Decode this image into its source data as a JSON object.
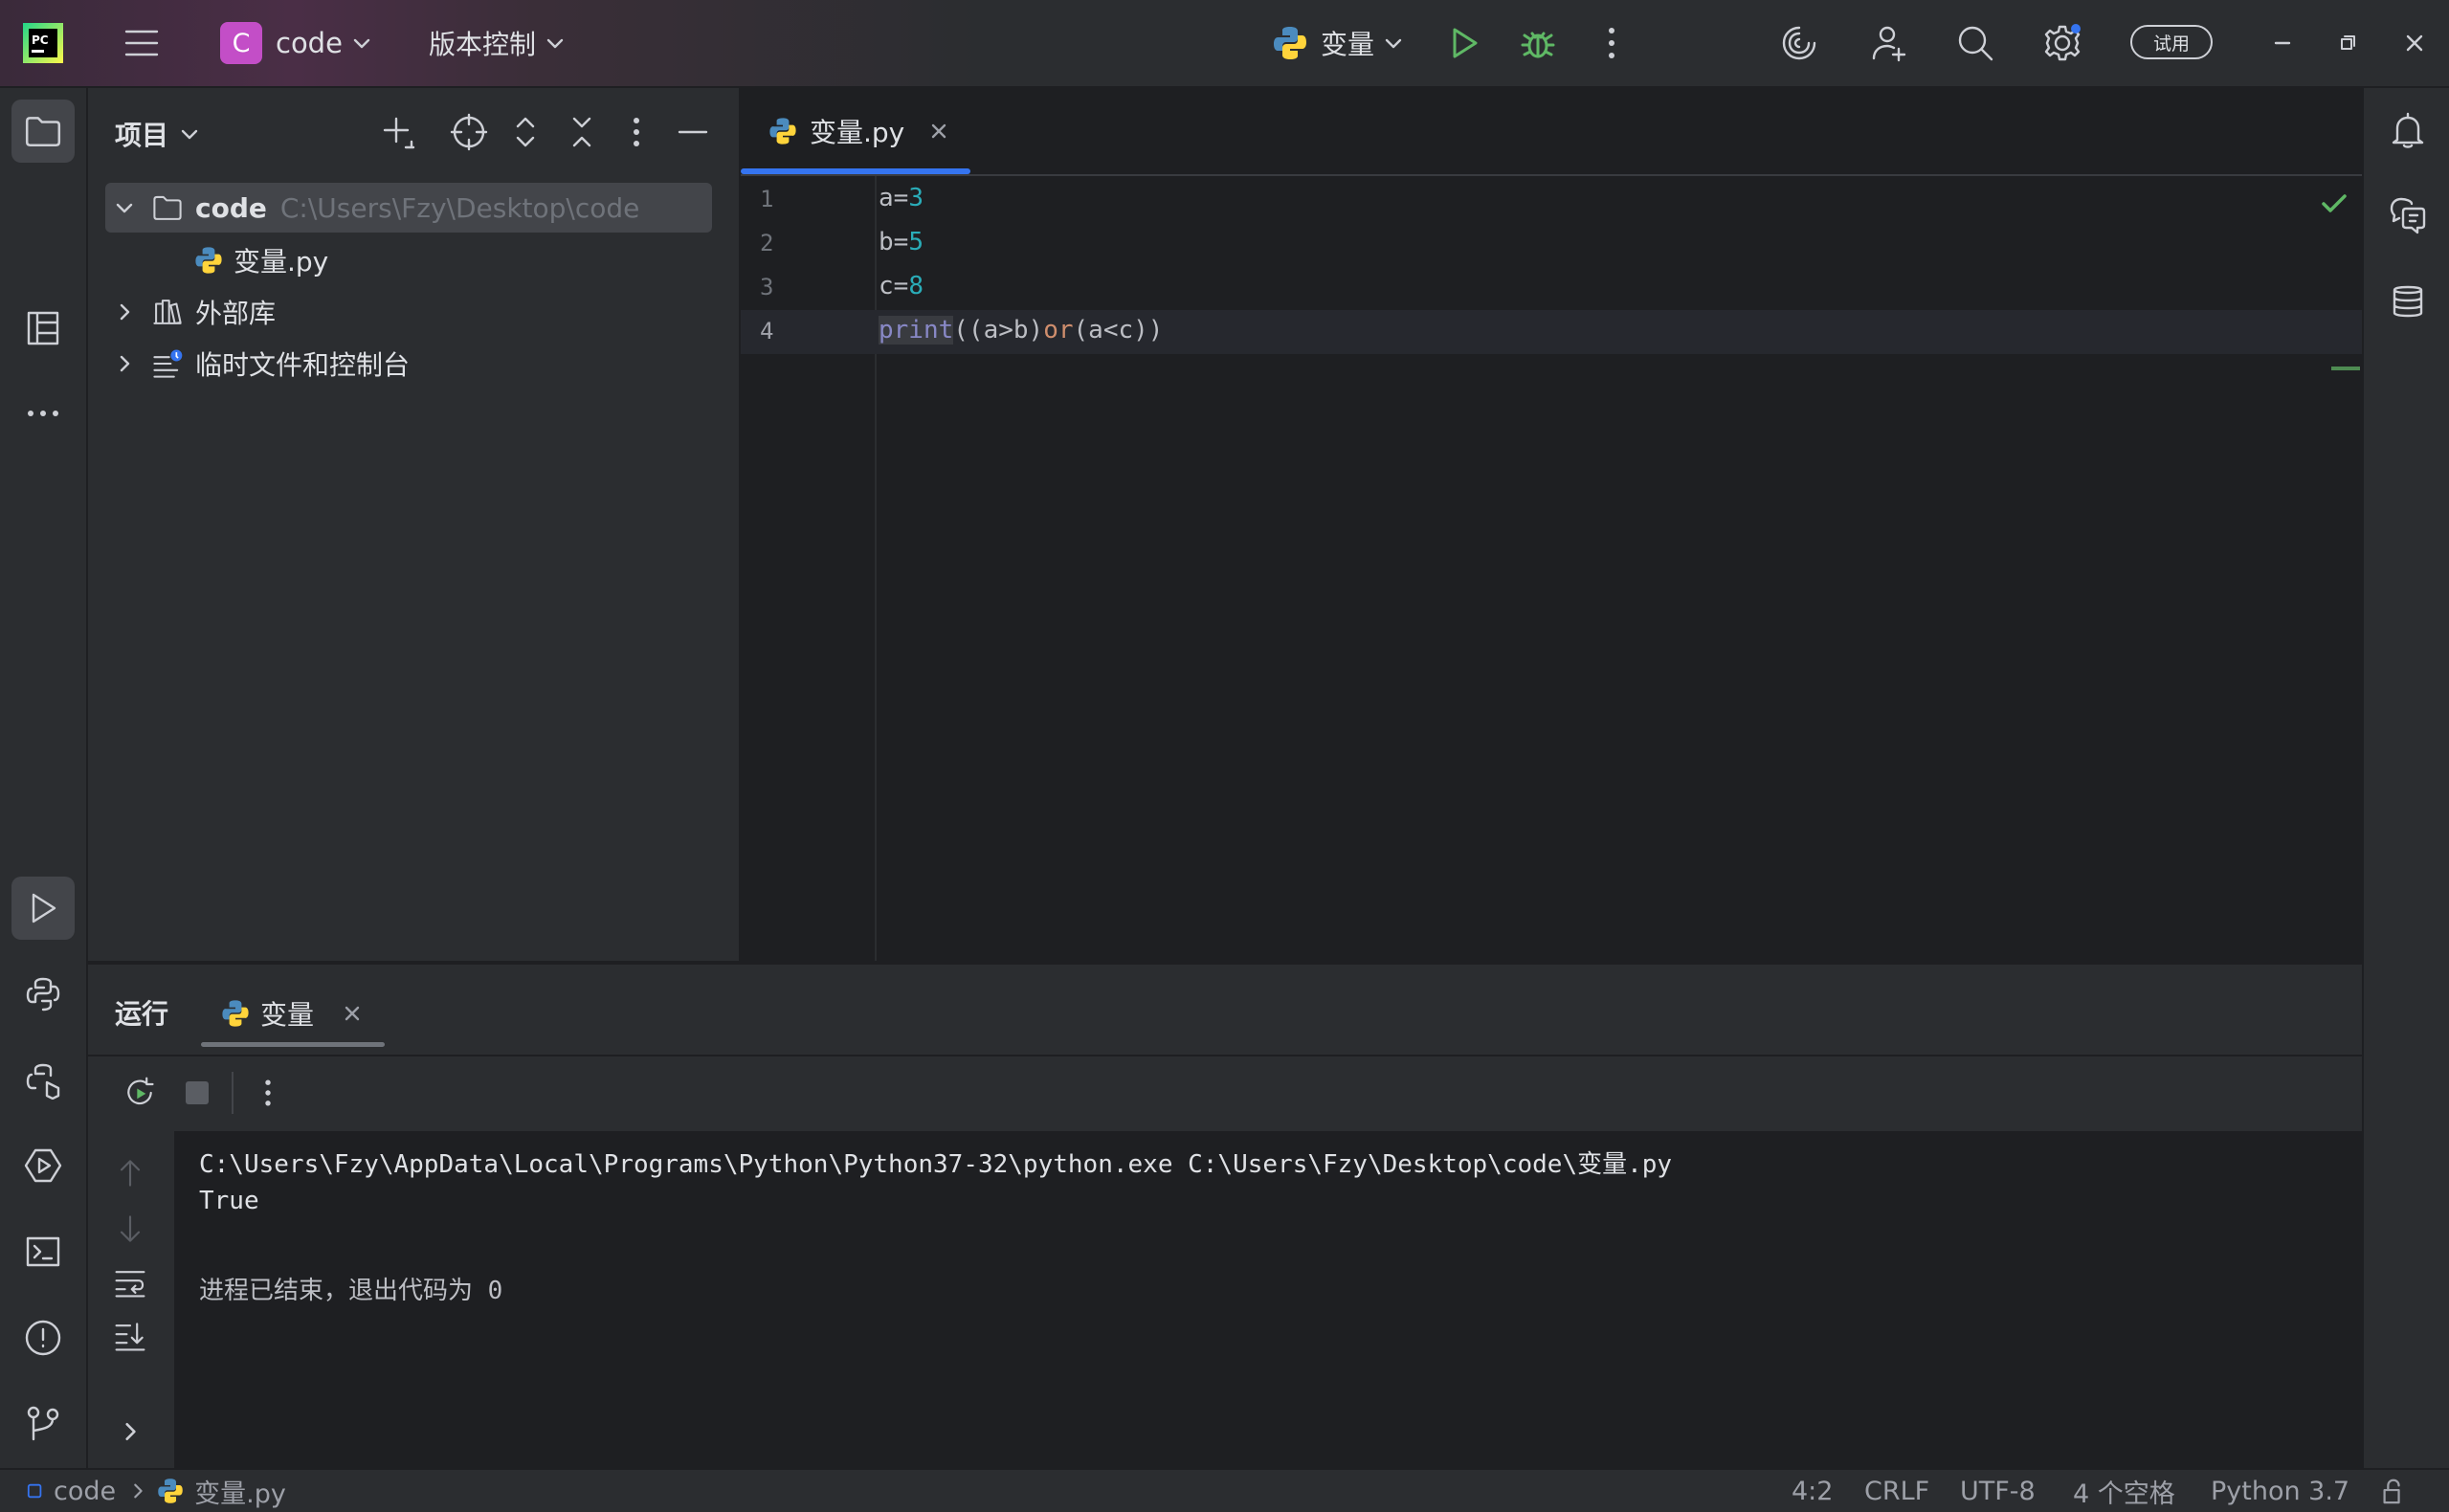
{
  "titlebar": {
    "project_badge": "C",
    "project_name": "code",
    "vcs_label": "版本控制",
    "run_config": "变量",
    "trial_label": "试用"
  },
  "project_panel": {
    "title": "项目",
    "root_name": "code",
    "root_path": "C:\\Users\\Fzy\\Desktop\\code",
    "file_name": "变量.py",
    "external_libs": "外部库",
    "scratches": "临时文件和控制台"
  },
  "editor": {
    "tab_name": "变量.py",
    "line_numbers": [
      "1",
      "2",
      "3",
      "4"
    ],
    "lines": [
      {
        "var": "a",
        "op": "=",
        "num": "3"
      },
      {
        "var": "b",
        "op": "=",
        "num": "5"
      },
      {
        "var": "c",
        "op": "=",
        "num": "8"
      }
    ],
    "line4": {
      "fn": "print",
      "p1": "((a>b)",
      "kw": "or",
      "p2": "(a<c))"
    }
  },
  "run_panel": {
    "title": "运行",
    "tab_name": "变量",
    "output": [
      "C:\\Users\\Fzy\\AppData\\Local\\Programs\\Python\\Python37-32\\python.exe C:\\Users\\Fzy\\Desktop\\code\\变量.py",
      "True",
      "",
      "进程已结束，退出代码为 0"
    ]
  },
  "statusbar": {
    "breadcrumb_project": "code",
    "breadcrumb_file": "变量.py",
    "caret": "4:2",
    "line_sep": "CRLF",
    "encoding": "UTF-8",
    "indent": "4 个空格",
    "interpreter": "Python 3.7"
  },
  "colors": {
    "accent": "#3574f0",
    "run_green": "#5fb865",
    "number": "#2aacb8",
    "keyword": "#cf8e6d",
    "builtin": "#8888c6",
    "path_gray": "#6f737a"
  }
}
